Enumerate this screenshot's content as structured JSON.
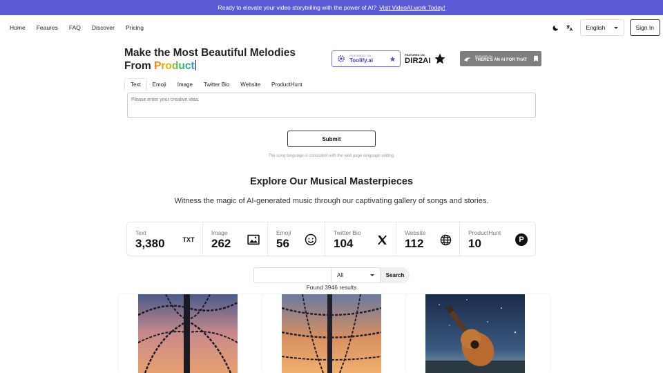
{
  "banner": {
    "text": "Ready to elevate your video storytelling with the power of AI?",
    "link": "Visit VideoAI.work Today!"
  },
  "nav": {
    "links": [
      "Home",
      "Feaures",
      "FAQ",
      "Discover",
      "Pricing"
    ],
    "language": "English",
    "sign_in": "Sign In"
  },
  "hero": {
    "line1": "Make the Most Beautiful Melodies",
    "line2_prefix": "From ",
    "line2_highlight": "Product"
  },
  "badges": {
    "toolify": {
      "small": "FEATURED ON",
      "big": "Toolify.ai"
    },
    "dir2ai": {
      "small": "FEATURED ON",
      "big": "DIR2AI"
    },
    "aiforthat": {
      "small": "FEATURED ON",
      "big": "THERE'S AN AI FOR THAT"
    }
  },
  "tabs": [
    "Text",
    "Emoji",
    "Image",
    "Twitter Bio",
    "Website",
    "ProductHunt"
  ],
  "input": {
    "placeholder": "Please enter your creative idea."
  },
  "submit": "Submit",
  "hint": "The song language is consistent with the web page language setting.",
  "gallery": {
    "title": "Explore Our Musical Masterpieces",
    "subtitle": "Witness the magic of AI-generated music through our captivating gallery of songs and stories."
  },
  "stats": [
    {
      "label": "Text",
      "value": "3,380",
      "icon": "txt-icon"
    },
    {
      "label": "Image",
      "value": "262",
      "icon": "image-icon"
    },
    {
      "label": "Emoji",
      "value": "56",
      "icon": "smiley-icon"
    },
    {
      "label": "Twitter Bio",
      "value": "104",
      "icon": "x-logo-icon"
    },
    {
      "label": "Website",
      "value": "112",
      "icon": "globe-icon"
    },
    {
      "label": "ProductHunt",
      "value": "10",
      "icon": "producthunt-icon"
    }
  ],
  "stat_txt_glyph": "TXT",
  "stat_ph_glyph": "P",
  "search": {
    "filter": "All",
    "button": "Search"
  },
  "found": "Found 3946 results",
  "colors": {
    "banner": "#5b5bd6",
    "accent": "#7c6fd6"
  }
}
